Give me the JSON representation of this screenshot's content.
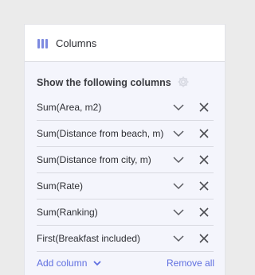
{
  "header": {
    "title": "Columns",
    "icon": "columns-icon"
  },
  "section": {
    "title": "Show the following columns",
    "icon": "gear-icon"
  },
  "columns": [
    {
      "label": "Sum(Area, m2)"
    },
    {
      "label": "Sum(Distance from beach, m)"
    },
    {
      "label": "Sum(Distance from city, m)"
    },
    {
      "label": "Sum(Rate)"
    },
    {
      "label": "Sum(Ranking)"
    },
    {
      "label": "First(Breakfast included)"
    }
  ],
  "footer": {
    "add_label": "Add column",
    "remove_all_label": "Remove all"
  },
  "colors": {
    "accent": "#5f6fe0",
    "icon_accent": "#7d8ae0",
    "panel_bg": "#f4f5fc",
    "page_bg": "#ebebeb"
  }
}
